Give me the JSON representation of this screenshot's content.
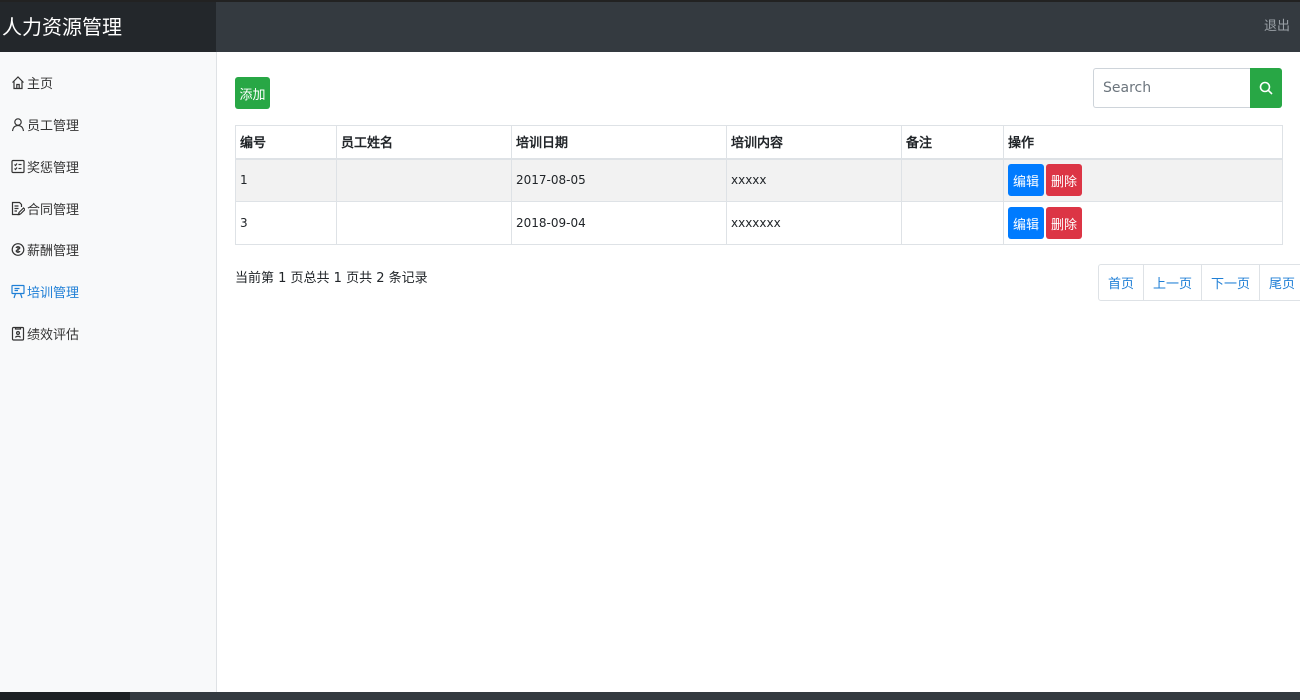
{
  "header": {
    "brand": "人力资源管理",
    "logout": "退出"
  },
  "sidebar": {
    "items": [
      {
        "label": "主页",
        "icon": "home-icon",
        "active": false
      },
      {
        "label": "员工管理",
        "icon": "user-icon",
        "active": false
      },
      {
        "label": "奖惩管理",
        "icon": "checklist-icon",
        "active": false
      },
      {
        "label": "合同管理",
        "icon": "document-edit-icon",
        "active": false
      },
      {
        "label": "薪酬管理",
        "icon": "coin-icon",
        "active": false
      },
      {
        "label": "培训管理",
        "icon": "presentation-icon",
        "active": true
      },
      {
        "label": "绩效评估",
        "icon": "report-icon",
        "active": false
      }
    ]
  },
  "toolbar": {
    "add_label": "添加",
    "search_placeholder": "Search",
    "search_icon": "search-icon"
  },
  "table": {
    "headers": [
      "编号",
      "员工姓名",
      "培训日期",
      "培训内容",
      "备注",
      "操作"
    ],
    "rows": [
      {
        "id": "1",
        "name": "",
        "date": "2017-08-05",
        "content": "xxxxx",
        "note": ""
      },
      {
        "id": "3",
        "name": "",
        "date": "2018-09-04",
        "content": "xxxxxxx",
        "note": ""
      }
    ],
    "edit_label": "编辑",
    "delete_label": "删除"
  },
  "footer": {
    "record_info": "当前第 1 页总共 1 页共 2 条记录"
  },
  "pagination": {
    "first": "首页",
    "prev": "上一页",
    "next": "下一页",
    "last": "尾页"
  },
  "colors": {
    "topbar": "#343a40",
    "brand_bg": "#23272b",
    "success": "#28a745",
    "primary": "#007bff",
    "danger": "#dc3545",
    "link": "#1f7fd6"
  }
}
